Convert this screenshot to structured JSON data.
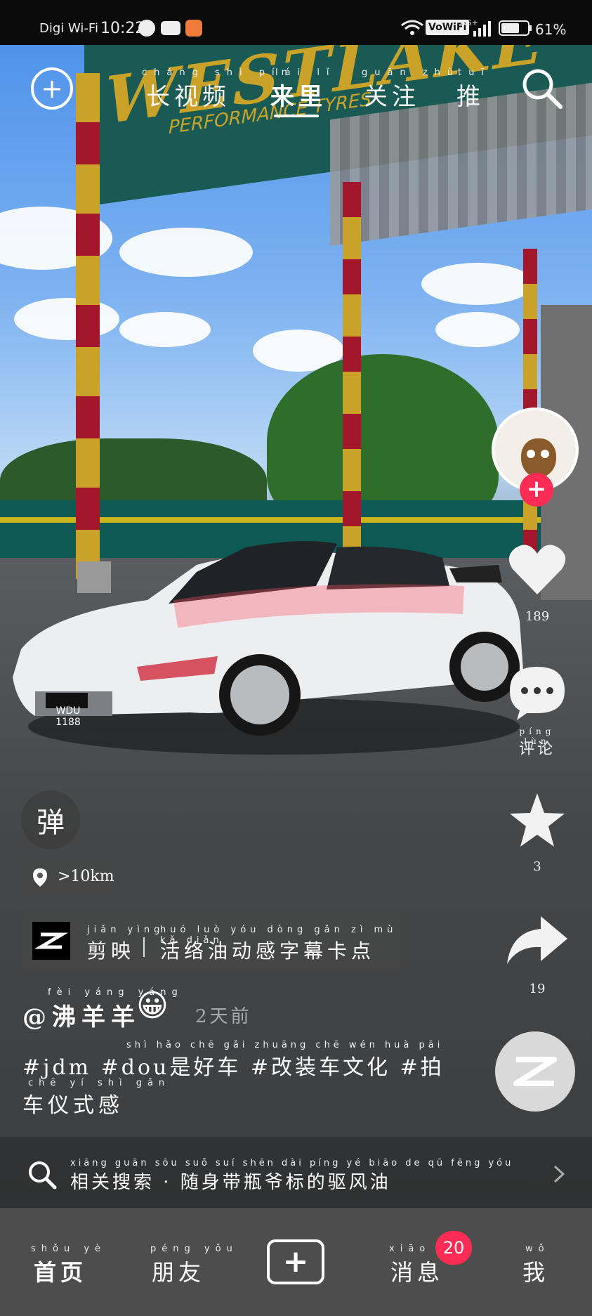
{
  "status_bar": {
    "carrier": "Digi Wi-Fi",
    "time": "10:22",
    "network_badge": "VoWiFi",
    "signal_label": "4G+",
    "battery": "61%"
  },
  "top_tabs": [
    {
      "label": "长视频",
      "ruby": "cháng shì pín"
    },
    {
      "label": "来里",
      "ruby": "lái lǐ",
      "active": true
    },
    {
      "label": "关注",
      "ruby": "guān zhù"
    },
    {
      "label": "推",
      "ruby": "tuī"
    }
  ],
  "scene": {
    "banner_text": "WESTLAKE",
    "banner_sub": "PERFORMANCE TYRES",
    "plate": "WDU 1188"
  },
  "right_rail": {
    "likes": "189",
    "comment_label": "评论",
    "comment_ruby": "píng lùn",
    "favorites": "3",
    "shares": "19"
  },
  "left_overlay": {
    "danmu_label": "弹",
    "location": ">10km",
    "capcut_label": "剪映",
    "capcut_ruby": "jiǎn yìng",
    "capcut_promo": "活络油动感字幕卡点",
    "capcut_promo_ruby": "huó luò yóu dòng gǎn zì mù kǎ diǎn"
  },
  "post": {
    "author": "@沸羊羊",
    "author_ruby": "fèi yáng yáng",
    "author_emoji": "😀",
    "time_ago": "2天前",
    "hashtags_line1": "#jdm #dou是好车 #改装车文化 #拍",
    "hashtags_line1_ruby": "shì hǎo chē   gǎi zhuāng chē wén huà   pāi",
    "hashtags_line2": "车仪式感",
    "hashtags_line2_ruby": "chē yí shì gǎn"
  },
  "related_search": {
    "text": "相关搜索 · 随身带瓶爷标的驱风油",
    "ruby": "xiāng guān sōu suǒ   suí shēn dài píng yé biāo de qū fēng yóu"
  },
  "bottom_nav": {
    "home": "首页",
    "home_ruby": "shǒu yè",
    "friends": "朋友",
    "friends_ruby": "péng yǒu",
    "messages": "消息",
    "messages_ruby": "xiāo xī",
    "messages_badge": "20",
    "me": "我",
    "me_ruby": "wǒ"
  },
  "colors": {
    "accent_red": "#fe2c55",
    "nav_bg": "#4d4d4d"
  }
}
